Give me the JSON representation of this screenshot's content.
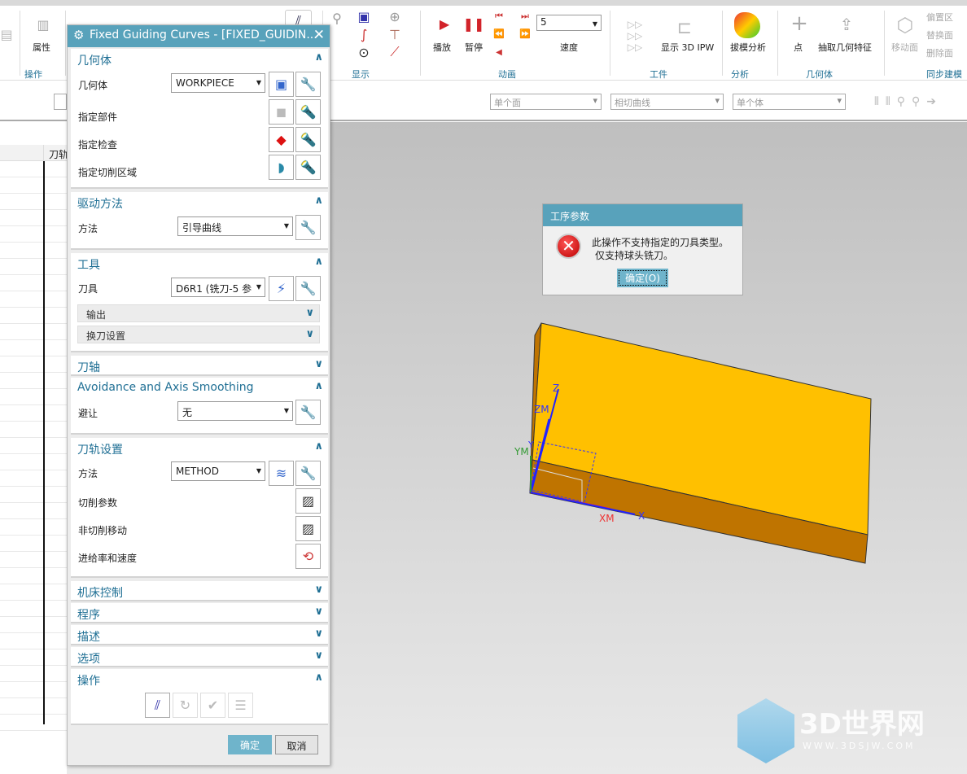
{
  "ribbon": {
    "groups": [
      "操作",
      "显示",
      "动画",
      "工件",
      "分析",
      "几何体",
      "同步建模"
    ],
    "buttons": {
      "properties": "属性",
      "play": "播放",
      "pause": "暂停",
      "speed_label": "速度",
      "speed_value": "5",
      "show_ipw": "显示 3D IPW",
      "draft_analysis": "拔模分析",
      "point": "点",
      "extract_geometry": "抽取几何特征",
      "move_face": "移动面",
      "offset_region": "偏置区",
      "replace_face": "替换面",
      "delete_face": "删除面"
    }
  },
  "toolbar2": {
    "face_filter": "单个面",
    "curve_filter": "相切曲线",
    "body_filter": "单个体"
  },
  "navigator": {
    "column_header": "刀轨"
  },
  "dialog": {
    "title": "Fixed Guiding Curves - [FIXED_GUIDIN...",
    "geometry": {
      "header": "几何体",
      "geometry_label": "几何体",
      "geometry_value": "WORKPIECE",
      "part_label": "指定部件",
      "check_label": "指定检查",
      "cut_area_label": "指定切削区域"
    },
    "drive": {
      "header": "驱动方法",
      "method_label": "方法",
      "method_value": "引导曲线"
    },
    "tool": {
      "header": "工具",
      "tool_label": "刀具",
      "tool_value": "D6R1 (铣刀-5 参",
      "output": "输出",
      "tool_change": "换刀设置"
    },
    "tool_axis": {
      "header": "刀轴"
    },
    "avoidance": {
      "header": "Avoidance and Axis Smoothing",
      "avoid_label": "避让",
      "avoid_value": "无"
    },
    "path_settings": {
      "header": "刀轨设置",
      "method_label": "方法",
      "method_value": "METHOD",
      "cut_params": "切削参数",
      "non_cut_moves": "非切削移动",
      "feeds_speeds": "进给率和速度"
    },
    "collapsed": [
      "机床控制",
      "程序",
      "描述",
      "选项"
    ],
    "actions": {
      "header": "操作"
    },
    "ok": "确定",
    "cancel": "取消"
  },
  "message": {
    "title": "工序参数",
    "line1": "此操作不支持指定的刀具类型。",
    "line2": "仅支持球头铣刀。",
    "ok": "确定(O)"
  },
  "axes": {
    "z": "Z",
    "zm": "ZM",
    "y": "Y",
    "ym": "YM",
    "x": "X",
    "xm": "XM"
  },
  "watermark": {
    "name": "3D世界网",
    "url": "WWW.3DSJW.COM"
  },
  "colors": {
    "accent": "#58a2bb",
    "part_top": "#ffc000",
    "part_side": "#bf7400",
    "error": "#c8161d"
  }
}
